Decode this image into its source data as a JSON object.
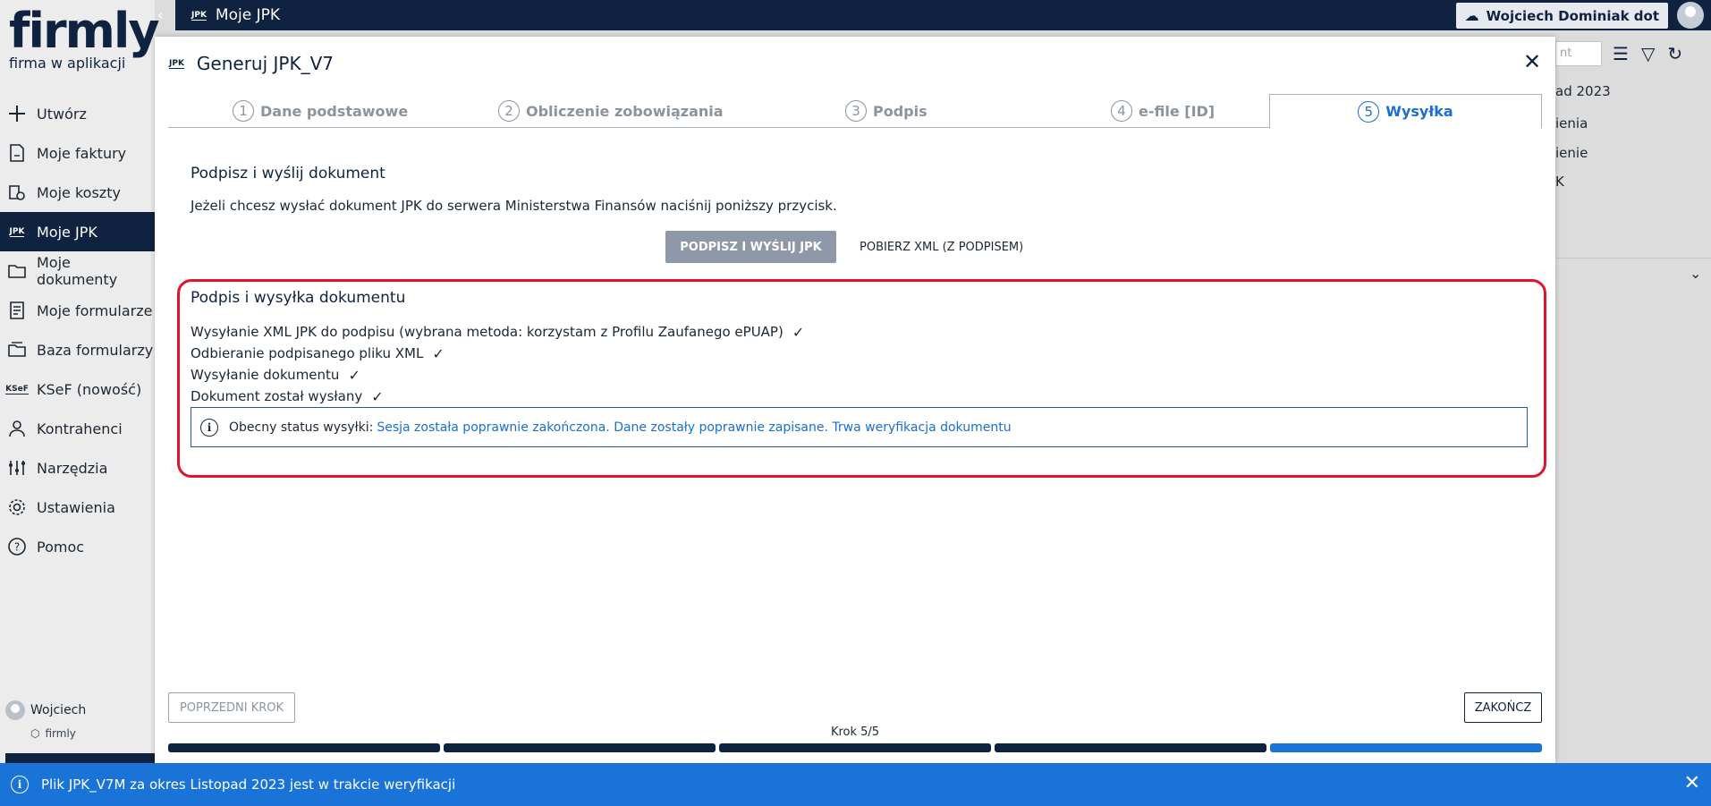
{
  "sidebar": {
    "logo": "firmly",
    "tagline": "firma w aplikacji",
    "items": [
      {
        "label": "Utwórz",
        "icon": "plus-icon",
        "active": false
      },
      {
        "label": "Moje faktury",
        "icon": "invoice-icon",
        "active": false
      },
      {
        "label": "Moje koszty",
        "icon": "costs-icon",
        "active": false
      },
      {
        "label": "Moje JPK",
        "icon": "jpk-icon",
        "active": true
      },
      {
        "label": "Moje dokumenty",
        "icon": "folder-icon",
        "active": false
      },
      {
        "label": "Moje formularze",
        "icon": "form-icon",
        "active": false
      },
      {
        "label": "Baza formularzy",
        "icon": "forms-base-icon",
        "active": false
      },
      {
        "label": "KSeF (nowość)",
        "icon": "ksef-icon",
        "active": false
      },
      {
        "label": "Kontrahenci",
        "icon": "person-icon",
        "active": false
      },
      {
        "label": "Narzędzia",
        "icon": "tools-icon",
        "active": false
      },
      {
        "label": "Ustawienia",
        "icon": "gear-icon",
        "active": false
      },
      {
        "label": "Pomoc",
        "icon": "help-icon",
        "active": false
      }
    ],
    "jpk_badge": "JPK",
    "ksef_badge": "KSeF",
    "user_name": "Wojciech",
    "company_name": "firmly"
  },
  "topbar": {
    "badge": "JPK",
    "title": "Moje JPK",
    "user_chip": "Wojciech Dominiak dot"
  },
  "background": {
    "search_placeholder": "nt",
    "texts": [
      "ad 2023",
      "ienia",
      "ienie",
      "K"
    ]
  },
  "modal": {
    "badge": "JPK",
    "title": "Generuj JPK_V7",
    "steps": [
      {
        "num": "1",
        "label": "Dane podstawowe"
      },
      {
        "num": "2",
        "label": "Obliczenie zobowiązania"
      },
      {
        "num": "3",
        "label": "Podpis"
      },
      {
        "num": "4",
        "label": "e-file [ID]"
      },
      {
        "num": "5",
        "label": "Wysyłka"
      }
    ],
    "active_step": 5,
    "section_title": "Podpisz i wyślij dokument",
    "section_desc": "Jeżeli chcesz wysłać dokument JPK do serwera Ministerstwa Finansów naciśnij poniższy przycisk.",
    "sign_send_button": "PODPISZ I WYŚLIJ JPK",
    "download_xml_link": "POBIERZ XML (Z PODPISEM)",
    "sign_box": {
      "title": "Podpis i wysyłka dokumentu",
      "checks": [
        "Wysyłanie XML JPK do podpisu (wybrana metoda: korzystam z Profilu Zaufanego ePUAP)",
        "Odbieranie podpisanego pliku XML",
        "Wysyłanie dokumentu",
        "Dokument został wysłany"
      ],
      "status_label": "Obecny status wysyłki:",
      "status_value": "Sesja została poprawnie zakończona. Dane zostały poprawnie zapisane. Trwa weryfikacja dokumentu"
    },
    "prev_button": "POPRZEDNI KROK",
    "finish_button": "ZAKOŃCZ",
    "step_counter": "Krok 5/5",
    "progress": {
      "current": 5,
      "total": 5
    }
  },
  "notification": {
    "text": "Plik JPK_V7M za okres Listopad 2023 jest w trakcie weryfikacji"
  },
  "colors": {
    "navy": "#0f2340",
    "accent_blue": "#1a73d6",
    "highlight_red": "#e0142b"
  }
}
